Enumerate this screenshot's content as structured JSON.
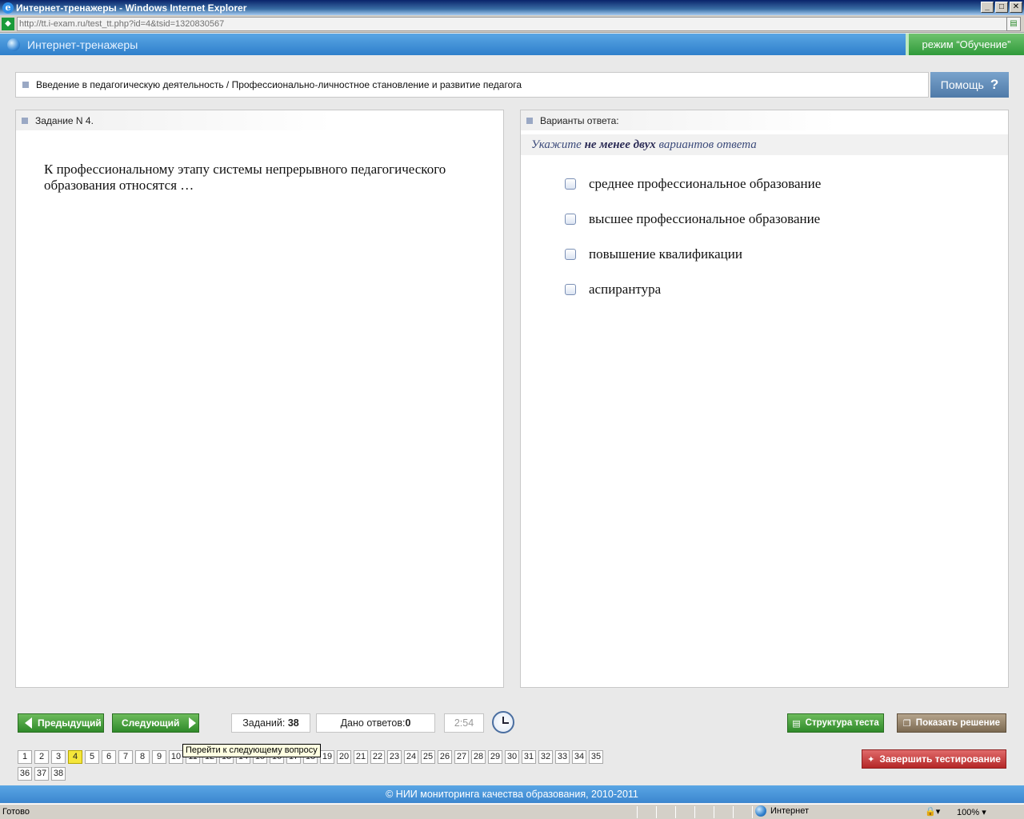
{
  "window": {
    "title": "Интернет-тренажеры - Windows Internet Explorer",
    "minimize": "_",
    "maximize": "□",
    "close": "✕"
  },
  "address": {
    "url": "http://tt.i-exam.ru/test_tt.php?id=4&tsid=1320830567"
  },
  "app": {
    "title": "Интернет-тренажеры",
    "mode": "режим “Обучение”"
  },
  "breadcrumb": {
    "text": "Введение в педагогическую деятельность / Профессионально-личностное становление и развитие педагога",
    "help_label": "Помощь",
    "help_icon": "?"
  },
  "task": {
    "header": "Задание N 4.",
    "question": "К профессиональному этапу системы непрерывного педагогического образования относятся …"
  },
  "answers": {
    "header": "Варианты ответа:",
    "hint_pre": "Укажите ",
    "hint_bold": "не менее двух",
    "hint_post": " вариантов ответа",
    "options": [
      {
        "label": "среднее профессиональное образование",
        "checked": false
      },
      {
        "label": "высшее профессиональное образование",
        "checked": false
      },
      {
        "label": "повышение квалификации",
        "checked": false
      },
      {
        "label": "аспирантура",
        "checked": false
      }
    ]
  },
  "controls": {
    "prev_label": "Предыдущий",
    "next_label": "Следующий",
    "tasks_label": "Заданий: ",
    "tasks_count": "38",
    "answered_label": "Дано ответов:",
    "answered_count": "0",
    "timer": "2:54",
    "structure_label": "Структура теста",
    "solution_label": "Показать решение",
    "finish_label": "Завершить тестирование",
    "tooltip": "Перейти к следующему вопросу"
  },
  "pager": {
    "pages": [
      "1",
      "2",
      "3",
      "4",
      "5",
      "6",
      "7",
      "8",
      "9",
      "10",
      "11",
      "12",
      "13",
      "14",
      "15",
      "16",
      "17",
      "18",
      "19",
      "20",
      "21",
      "22",
      "23",
      "24",
      "25",
      "26",
      "27",
      "28",
      "29",
      "30",
      "31",
      "32",
      "33",
      "34",
      "35",
      "36",
      "37",
      "38"
    ],
    "active": "4"
  },
  "footer": {
    "copyright": "© НИИ мониторинга качества образования, 2010-2011"
  },
  "status": {
    "ready": "Готово",
    "zone": "Интернет",
    "zoom": "100%"
  },
  "colors": {
    "header_blue": "#2f7fcb",
    "button_green": "#2f8a2a",
    "finish_red": "#b42727",
    "active_page": "#f5e63a"
  }
}
